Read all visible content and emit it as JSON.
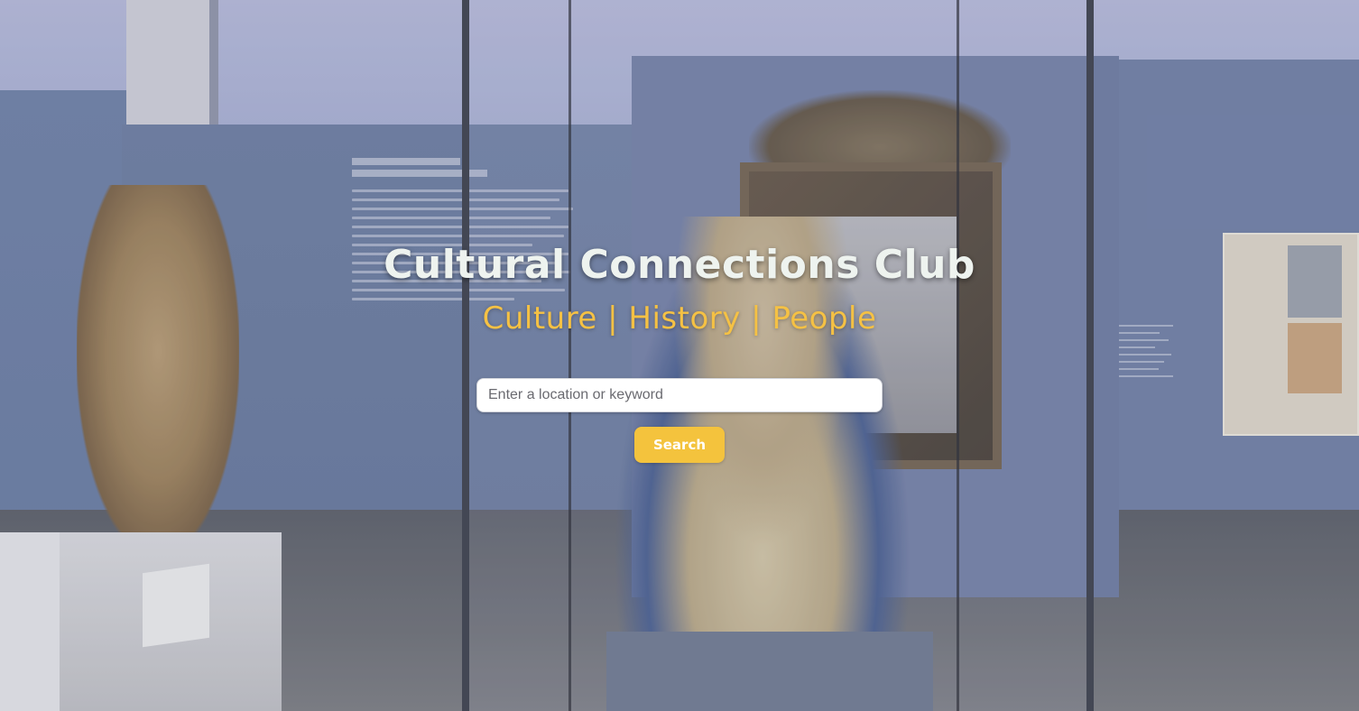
{
  "hero": {
    "title": "Cultural Connections Club",
    "tagline": "Culture | History | People"
  },
  "search": {
    "placeholder": "Enter a location or keyword",
    "value": "",
    "button_label": "Search"
  },
  "colors": {
    "title_text": "#eef3ef",
    "tagline_accent": "#f5c144",
    "button_bg": "#f4c33d",
    "button_text": "#ffffff"
  }
}
